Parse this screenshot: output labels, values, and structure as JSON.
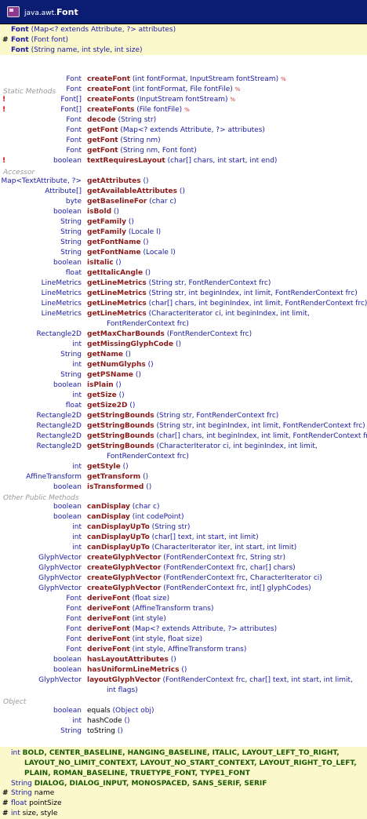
{
  "title": {
    "package": "java.awt.",
    "class": "Font"
  },
  "constructors": [
    {
      "mark": "",
      "name": "Font",
      "params": "(Map<? extends Attribute, ?> attributes)"
    },
    {
      "mark": "#",
      "name": "Font",
      "params": "(Font font)"
    },
    {
      "mark": "",
      "name": "Font",
      "params": "(String name, int style, int size)"
    }
  ],
  "sections": {
    "static": "Static Methods",
    "accessor": "Accessor",
    "other": "Other Public Methods",
    "object": "Object"
  },
  "static_methods": [
    {
      "mark": "",
      "type": "Font",
      "name": "createFont",
      "params": "(int fontFormat, InputStream fontStream)",
      "pct": "%"
    },
    {
      "mark": "",
      "type": "Font",
      "name": "createFont",
      "params": "(int fontFormat, File fontFile)",
      "pct": "%"
    },
    {
      "mark": "!",
      "type": "Font[]",
      "name": "createFonts",
      "params": "(InputStream fontStream)",
      "pct": "%"
    },
    {
      "mark": "!",
      "type": "Font[]",
      "name": "createFonts",
      "params": "(File fontFile)",
      "pct": "%"
    },
    {
      "mark": "",
      "type": "Font",
      "name": "decode",
      "params": "(String str)",
      "pct": ""
    },
    {
      "mark": "",
      "type": "Font",
      "name": "getFont",
      "params": "(Map<? extends Attribute, ?> attributes)",
      "pct": ""
    },
    {
      "mark": "",
      "type": "Font",
      "name": "getFont",
      "params": "(String nm)",
      "pct": ""
    },
    {
      "mark": "",
      "type": "Font",
      "name": "getFont",
      "params": "(String nm, Font font)",
      "pct": ""
    },
    {
      "mark": "!",
      "type": "boolean",
      "name": "textRequiresLayout",
      "params": "(char[] chars, int start, int end)",
      "pct": ""
    }
  ],
  "accessor_methods": [
    {
      "type": "Map<TextAttribute, ?>",
      "name": "getAttributes",
      "params": "()",
      "cont": ""
    },
    {
      "type": "Attribute[]",
      "name": "getAvailableAttributes",
      "params": "()",
      "cont": ""
    },
    {
      "type": "byte",
      "name": "getBaselineFor",
      "params": "(char c)",
      "cont": ""
    },
    {
      "type": "boolean",
      "name": "isBold",
      "params": "()",
      "cont": ""
    },
    {
      "type": "String",
      "name": "getFamily",
      "params": "()",
      "cont": ""
    },
    {
      "type": "String",
      "name": "getFamily",
      "params": "(Locale l)",
      "cont": ""
    },
    {
      "type": "String",
      "name": "getFontName",
      "params": "()",
      "cont": ""
    },
    {
      "type": "String",
      "name": "getFontName",
      "params": "(Locale l)",
      "cont": ""
    },
    {
      "type": "boolean",
      "name": "isItalic",
      "params": "()",
      "cont": ""
    },
    {
      "type": "float",
      "name": "getItalicAngle",
      "params": "()",
      "cont": ""
    },
    {
      "type": "LineMetrics",
      "name": "getLineMetrics",
      "params": "(String str, FontRenderContext frc)",
      "cont": ""
    },
    {
      "type": "LineMetrics",
      "name": "getLineMetrics",
      "params": "(String str, int beginIndex, int limit, FontRenderContext frc)",
      "cont": ""
    },
    {
      "type": "LineMetrics",
      "name": "getLineMetrics",
      "params": "(char[] chars, int beginIndex, int limit, FontRenderContext frc)",
      "cont": ""
    },
    {
      "type": "LineMetrics",
      "name": "getLineMetrics",
      "params": "(CharacterIterator ci, int beginIndex, int limit,",
      "cont": "FontRenderContext frc)"
    },
    {
      "type": "Rectangle2D",
      "name": "getMaxCharBounds",
      "params": "(FontRenderContext frc)",
      "cont": ""
    },
    {
      "type": "int",
      "name": "getMissingGlyphCode",
      "params": "()",
      "cont": ""
    },
    {
      "type": "String",
      "name": "getName",
      "params": "()",
      "cont": ""
    },
    {
      "type": "int",
      "name": "getNumGlyphs",
      "params": "()",
      "cont": ""
    },
    {
      "type": "String",
      "name": "getPSName",
      "params": "()",
      "cont": ""
    },
    {
      "type": "boolean",
      "name": "isPlain",
      "params": "()",
      "cont": ""
    },
    {
      "type": "int",
      "name": "getSize",
      "params": "()",
      "cont": ""
    },
    {
      "type": "float",
      "name": "getSize2D",
      "params": "()",
      "cont": ""
    },
    {
      "type": "Rectangle2D",
      "name": "getStringBounds",
      "params": "(String str, FontRenderContext frc)",
      "cont": ""
    },
    {
      "type": "Rectangle2D",
      "name": "getStringBounds",
      "params": "(String str, int beginIndex, int limit, FontRenderContext frc)",
      "cont": ""
    },
    {
      "type": "Rectangle2D",
      "name": "getStringBounds",
      "params": "(char[] chars, int beginIndex, int limit, FontRenderContext frc)",
      "cont": ""
    },
    {
      "type": "Rectangle2D",
      "name": "getStringBounds",
      "params": "(CharacterIterator ci, int beginIndex, int limit,",
      "cont": "FontRenderContext frc)"
    },
    {
      "type": "int",
      "name": "getStyle",
      "params": "()",
      "cont": ""
    },
    {
      "type": "AffineTransform",
      "name": "getTransform",
      "params": "()",
      "cont": ""
    },
    {
      "type": "boolean",
      "name": "isTransformed",
      "params": "()",
      "cont": ""
    }
  ],
  "other_methods": [
    {
      "type": "boolean",
      "name": "canDisplay",
      "params": "(char c)",
      "cont": ""
    },
    {
      "type": "boolean",
      "name": "canDisplay",
      "params": "(int codePoint)",
      "cont": ""
    },
    {
      "type": "int",
      "name": "canDisplayUpTo",
      "params": "(String str)",
      "cont": ""
    },
    {
      "type": "int",
      "name": "canDisplayUpTo",
      "params": "(char[] text, int start, int limit)",
      "cont": ""
    },
    {
      "type": "int",
      "name": "canDisplayUpTo",
      "params": "(CharacterIterator iter, int start, int limit)",
      "cont": ""
    },
    {
      "type": "GlyphVector",
      "name": "createGlyphVector",
      "params": "(FontRenderContext frc, String str)",
      "cont": ""
    },
    {
      "type": "GlyphVector",
      "name": "createGlyphVector",
      "params": "(FontRenderContext frc, char[] chars)",
      "cont": ""
    },
    {
      "type": "GlyphVector",
      "name": "createGlyphVector",
      "params": "(FontRenderContext frc, CharacterIterator ci)",
      "cont": ""
    },
    {
      "type": "GlyphVector",
      "name": "createGlyphVector",
      "params": "(FontRenderContext frc, int[] glyphCodes)",
      "cont": ""
    },
    {
      "type": "Font",
      "name": "deriveFont",
      "params": "(float size)",
      "cont": ""
    },
    {
      "type": "Font",
      "name": "deriveFont",
      "params": "(AffineTransform trans)",
      "cont": ""
    },
    {
      "type": "Font",
      "name": "deriveFont",
      "params": "(int style)",
      "cont": ""
    },
    {
      "type": "Font",
      "name": "deriveFont",
      "params": "(Map<? extends Attribute, ?> attributes)",
      "cont": ""
    },
    {
      "type": "Font",
      "name": "deriveFont",
      "params": "(int style, float size)",
      "cont": ""
    },
    {
      "type": "Font",
      "name": "deriveFont",
      "params": "(int style, AffineTransform trans)",
      "cont": ""
    },
    {
      "type": "boolean",
      "name": "hasLayoutAttributes",
      "params": "()",
      "cont": ""
    },
    {
      "type": "boolean",
      "name": "hasUniformLineMetrics",
      "params": "()",
      "cont": ""
    },
    {
      "type": "GlyphVector",
      "name": "layoutGlyphVector",
      "params": "(FontRenderContext frc, char[] text, int start, int limit,",
      "cont": "int flags)"
    }
  ],
  "object_methods": [
    {
      "type": "boolean",
      "name": "equals",
      "params": "(Object obj)"
    },
    {
      "type": "int",
      "name": "hashCode",
      "params": "()"
    },
    {
      "type": "String",
      "name": "toString",
      "params": "()"
    }
  ],
  "constants": [
    {
      "type": "int",
      "names": "BOLD, CENTER_BASELINE, HANGING_BASELINE, ITALIC, LAYOUT_LEFT_TO_RIGHT,"
    },
    {
      "type": "",
      "names": "LAYOUT_NO_LIMIT_CONTEXT, LAYOUT_NO_START_CONTEXT, LAYOUT_RIGHT_TO_LEFT,"
    },
    {
      "type": "",
      "names": "PLAIN, ROMAN_BASELINE, TRUETYPE_FONT, TYPE1_FONT"
    },
    {
      "type": "String",
      "names": "DIALOG, DIALOG_INPUT, MONOSPACED, SANS_SERIF, SERIF"
    }
  ],
  "fields": [
    {
      "mark": "#",
      "type": "String",
      "names": "name"
    },
    {
      "mark": "#",
      "type": "float",
      "names": "pointSize"
    },
    {
      "mark": "#",
      "type": "int",
      "names": "size, style"
    }
  ],
  "colors": {
    "title_bg": "#0b1d73",
    "band_bg": "#fbf8cc",
    "method_name": "#8b1a1a",
    "type": "#1a1aa6",
    "section": "#9a9a9a",
    "error_mark": "#cc0000",
    "constant": "#1a5a00"
  }
}
